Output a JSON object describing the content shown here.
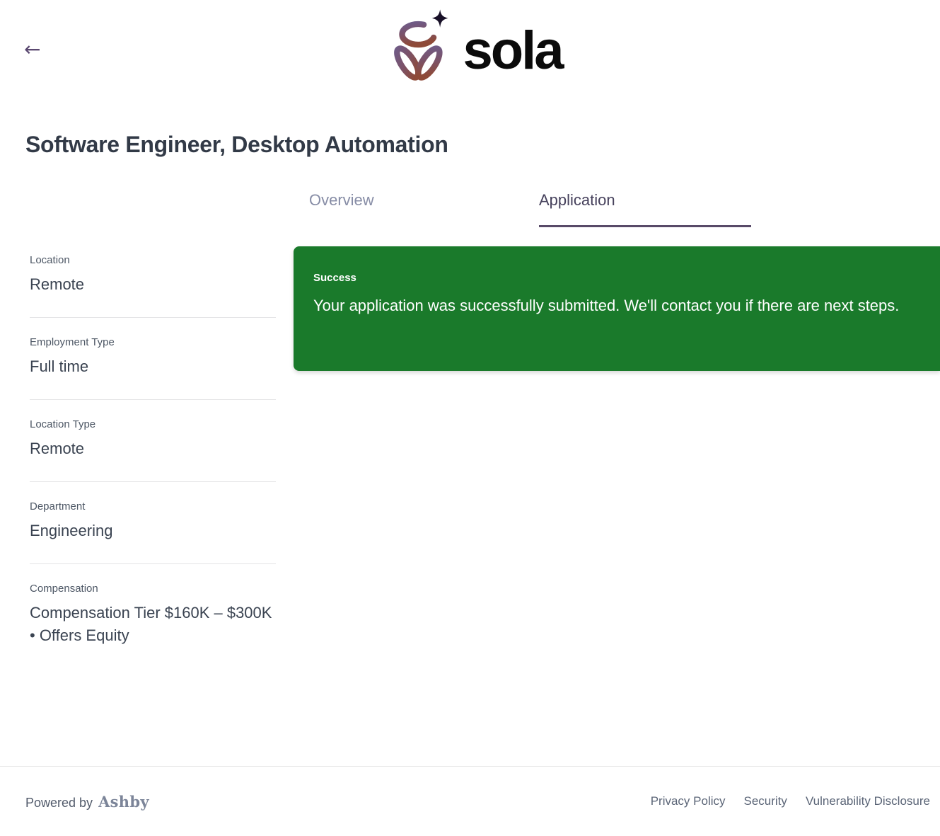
{
  "header": {
    "back_icon": "←",
    "brand": "sola"
  },
  "page": {
    "title": "Software Engineer, Desktop Automation"
  },
  "tabs": [
    {
      "label": "Overview",
      "active": false
    },
    {
      "label": "Application",
      "active": true
    }
  ],
  "sidebar": {
    "sections": [
      {
        "label": "Location",
        "value": "Remote"
      },
      {
        "label": "Employment Type",
        "value": "Full time"
      },
      {
        "label": "Location Type",
        "value": "Remote"
      },
      {
        "label": "Department",
        "value": "Engineering"
      },
      {
        "label": "Compensation",
        "value": "Compensation Tier $160K – $300K • Offers Equity"
      }
    ]
  },
  "banner": {
    "title": "Success",
    "message": "Your application was successfully submitted. We'll contact you if there are next steps."
  },
  "footer": {
    "powered_by": "Powered by",
    "brand": "Ashby",
    "links": [
      "Privacy Policy",
      "Security",
      "Vulnerability Disclosure"
    ]
  },
  "colors": {
    "success_green": "#1a7a2b",
    "accent_purple": "#584a68",
    "active_tab_text": "#46415c",
    "inactive_tab_text": "#878da6",
    "title_text": "#323a47",
    "logo_gradient_top": "#6f5b87",
    "logo_gradient_bottom": "#8e4a38",
    "footer_link_text": "#5b6577"
  }
}
